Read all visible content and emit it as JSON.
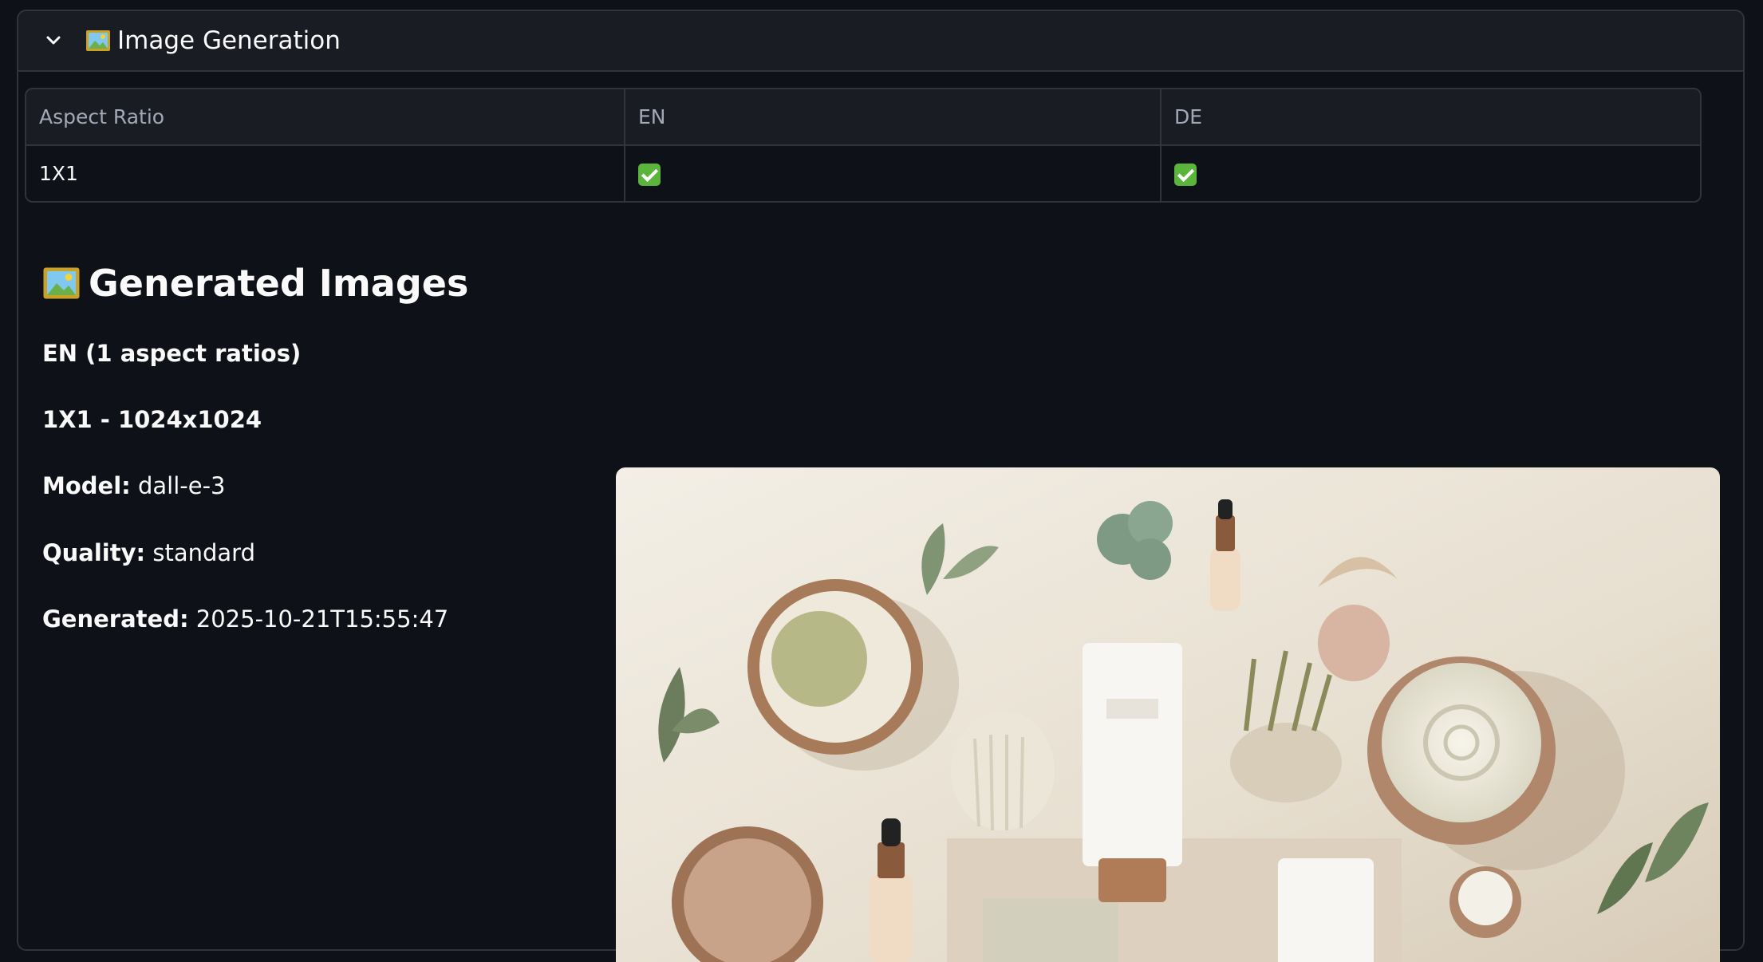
{
  "expander": {
    "title": "Image Generation",
    "expanded": true
  },
  "status_table": {
    "columns": [
      "Aspect Ratio",
      "EN",
      "DE"
    ],
    "rows": [
      {
        "aspect_ratio": "1X1",
        "en": true,
        "de": true
      }
    ]
  },
  "generated": {
    "heading": "Generated Images",
    "language_header": "EN (1 aspect ratios)",
    "ratio_header": "1X1 - 1024x1024",
    "model_label": "Model:",
    "model_value": "dall-e-3",
    "quality_label": "Quality:",
    "quality_value": "standard",
    "generated_label": "Generated:",
    "generated_value": "2025-10-21T15:55:47"
  },
  "icons": {
    "chevron": "chevron-down-icon",
    "frame": "framed-picture-icon",
    "check": "check-mark-button-icon"
  },
  "colors": {
    "background": "#0e1117",
    "header_bg": "#1a1c24",
    "border": "#31333f",
    "check_green": "#5bb43c"
  }
}
